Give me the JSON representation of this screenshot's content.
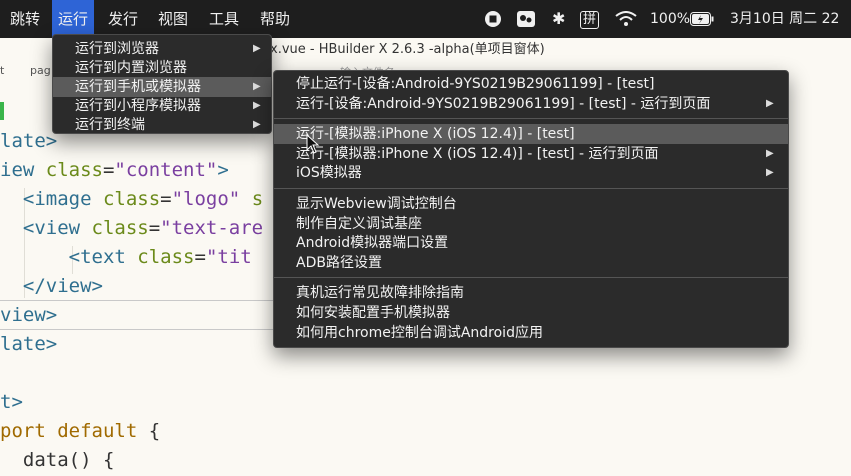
{
  "menubar": {
    "items": [
      "跳转",
      "运行",
      "发行",
      "视图",
      "工具",
      "帮助"
    ],
    "active_index": 1,
    "battery": "100%",
    "ime_badge": "拼",
    "datetime": "3月10日 周二 22"
  },
  "window": {
    "title": "x.vue - HBuilder X 2.6.3 -alpha(单项目窗体)",
    "tab_prefix": "t",
    "tab_path": "pag",
    "ghost_text": "输入文件名"
  },
  "code_lines": [
    {
      "parts": [
        {
          "t": "late>",
          "c": "c-tag"
        }
      ]
    },
    {
      "parts": [
        {
          "t": "iew ",
          "c": "c-tag"
        },
        {
          "t": "class",
          "c": "c-attr"
        },
        {
          "t": "=",
          "c": "c-plain"
        },
        {
          "t": "\"content\"",
          "c": "c-str"
        },
        {
          "t": ">",
          "c": "c-tag"
        }
      ]
    },
    {
      "parts": [
        {
          "t": "  <image ",
          "c": "c-tag"
        },
        {
          "t": "class",
          "c": "c-attr"
        },
        {
          "t": "=",
          "c": "c-plain"
        },
        {
          "t": "\"logo\"",
          "c": "c-str"
        },
        {
          "t": " s",
          "c": "c-attr"
        }
      ]
    },
    {
      "parts": [
        {
          "t": "  <view ",
          "c": "c-tag"
        },
        {
          "t": "class",
          "c": "c-attr"
        },
        {
          "t": "=",
          "c": "c-plain"
        },
        {
          "t": "\"text-are",
          "c": "c-str"
        }
      ]
    },
    {
      "parts": [
        {
          "t": "      <text ",
          "c": "c-tag"
        },
        {
          "t": "class",
          "c": "c-attr"
        },
        {
          "t": "=",
          "c": "c-plain"
        },
        {
          "t": "\"tit",
          "c": "c-str"
        }
      ]
    },
    {
      "parts": [
        {
          "t": "  </view>",
          "c": "c-tag"
        }
      ]
    },
    {
      "parts": [
        {
          "t": "view>",
          "c": "c-tag"
        }
      ]
    },
    {
      "parts": [
        {
          "t": "late>",
          "c": "c-tag"
        }
      ]
    },
    {
      "parts": []
    },
    {
      "parts": [
        {
          "t": "t>",
          "c": "c-tag"
        }
      ]
    },
    {
      "parts": [
        {
          "t": "port ",
          "c": "c-kw"
        },
        {
          "t": "default",
          "c": "c-kw"
        },
        {
          "t": " {",
          "c": "c-plain"
        }
      ]
    },
    {
      "parts": [
        {
          "t": "  data() {",
          "c": "c-plain"
        }
      ]
    }
  ],
  "run_menu": {
    "items": [
      {
        "label": "运行到浏览器",
        "submenu": true
      },
      {
        "label": "运行到内置浏览器",
        "submenu": false
      },
      {
        "label": "运行到手机或模拟器",
        "submenu": true,
        "highlighted": true
      },
      {
        "label": "运行到小程序模拟器",
        "submenu": true
      },
      {
        "label": "运行到终端",
        "submenu": true
      }
    ]
  },
  "device_menu": {
    "groups": [
      [
        {
          "label": "停止运行-[设备:Android-9YS0219B29061199] - [test]",
          "submenu": false
        },
        {
          "label": "运行-[设备:Android-9YS0219B29061199] - [test] - 运行到页面",
          "submenu": true
        }
      ],
      [
        {
          "label": "运行-[模拟器:iPhone X (iOS 12.4)] - [test]",
          "submenu": false,
          "highlighted": true
        },
        {
          "label": "运行-[模拟器:iPhone X (iOS 12.4)] - [test] - 运行到页面",
          "submenu": true
        },
        {
          "label": "iOS模拟器",
          "submenu": true
        }
      ],
      [
        {
          "label": "显示Webview调试控制台",
          "submenu": false
        },
        {
          "label": "制作自定义调试基座",
          "submenu": false
        },
        {
          "label": "Android模拟器端口设置",
          "submenu": false
        },
        {
          "label": "ADB路径设置",
          "submenu": false
        }
      ],
      [
        {
          "label": "真机运行常见故障排除指南",
          "submenu": false
        },
        {
          "label": "如何安装配置手机模拟器",
          "submenu": false
        },
        {
          "label": "如何用chrome控制台调试Android应用",
          "submenu": false
        }
      ]
    ]
  },
  "icons": {
    "arrow": "▶",
    "stop": "stop-circle-icon",
    "wechat": "wechat-icon",
    "bluetooth": "bluetooth-icon",
    "wifi": "wifi-icon",
    "battery": "battery-charging-icon"
  }
}
